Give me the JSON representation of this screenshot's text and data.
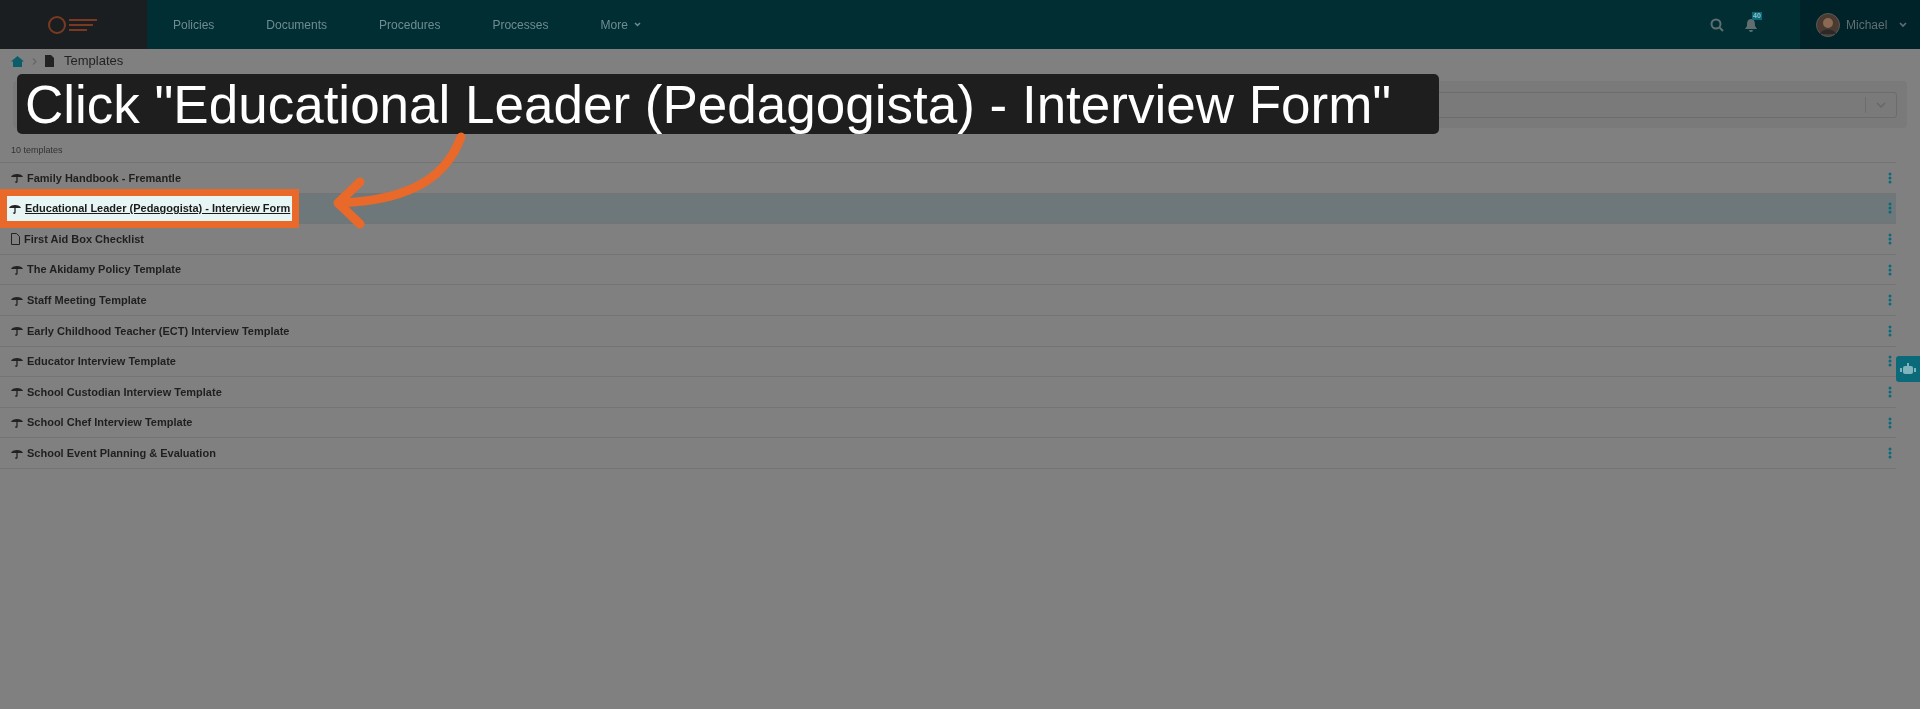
{
  "nav": {
    "items": [
      {
        "label": "Policies"
      },
      {
        "label": "Documents"
      },
      {
        "label": "Procedures"
      },
      {
        "label": "Processes"
      },
      {
        "label": "More",
        "has_menu": true
      }
    ],
    "notification_count": "40",
    "user": "Michael"
  },
  "breadcrumb": {
    "current": "Templates"
  },
  "count": "10 templates",
  "rows": [
    {
      "title": "Family Handbook - Fremantle",
      "kind": "umbrella",
      "selected": false
    },
    {
      "title": "Educational Leader (Pedagogista) - Interview Form",
      "kind": "umbrella",
      "selected": true
    },
    {
      "title": "First Aid Box Checklist",
      "kind": "file",
      "selected": false
    },
    {
      "title": "The Akidamy Policy Template",
      "kind": "umbrella",
      "selected": false
    },
    {
      "title": "Staff Meeting Template",
      "kind": "umbrella",
      "selected": false
    },
    {
      "title": "Early Childhood Teacher (ECT) Interview Template",
      "kind": "umbrella",
      "selected": false
    },
    {
      "title": "Educator Interview Template",
      "kind": "umbrella",
      "selected": false
    },
    {
      "title": "School Custodian Interview Template",
      "kind": "umbrella",
      "selected": false
    },
    {
      "title": "School Chef Interview Template",
      "kind": "umbrella",
      "selected": false
    },
    {
      "title": "School Event Planning & Evaluation",
      "kind": "umbrella",
      "selected": false
    }
  ],
  "callout": {
    "text": "Click \"Educational Leader (Pedagogista) - Interview Form\""
  }
}
